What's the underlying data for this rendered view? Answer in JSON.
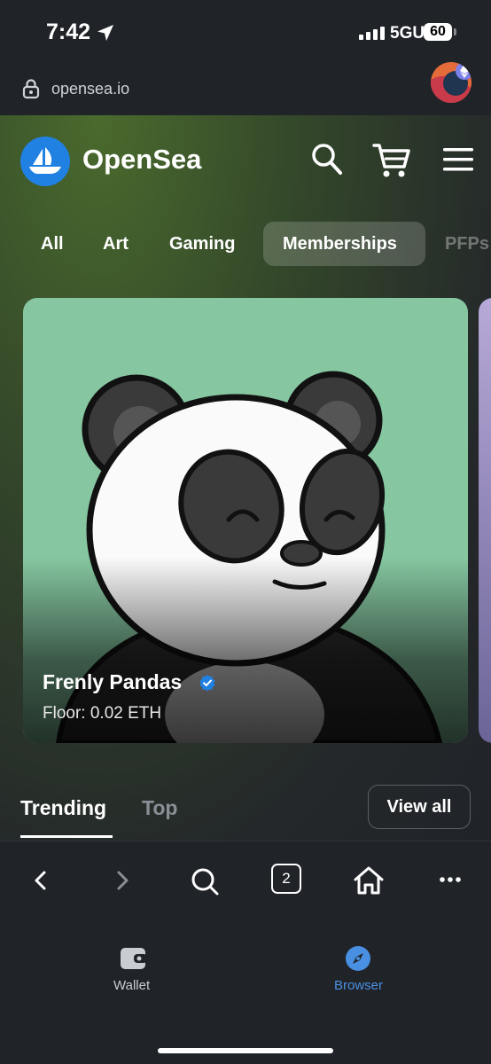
{
  "status_bar": {
    "time": "7:42",
    "network": "5GUC",
    "battery": "60"
  },
  "url_bar": {
    "url": "opensea.io"
  },
  "header": {
    "brand": "OpenSea"
  },
  "categories": [
    "All",
    "Art",
    "Gaming",
    "Memberships",
    "PFPs"
  ],
  "active_category": "Memberships",
  "featured": {
    "name": "Frenly Pandas",
    "floor": "Floor: 0.02 ETH",
    "verified": true
  },
  "section_tabs": {
    "trending": "Trending",
    "top": "Top",
    "view_all": "View all"
  },
  "browser_toolbar": {
    "tab_count": "2"
  },
  "bottom_tabs": {
    "wallet": "Wallet",
    "browser": "Browser"
  },
  "colors": {
    "accent": "#2081e2",
    "active_tab": "#4a90e2"
  }
}
